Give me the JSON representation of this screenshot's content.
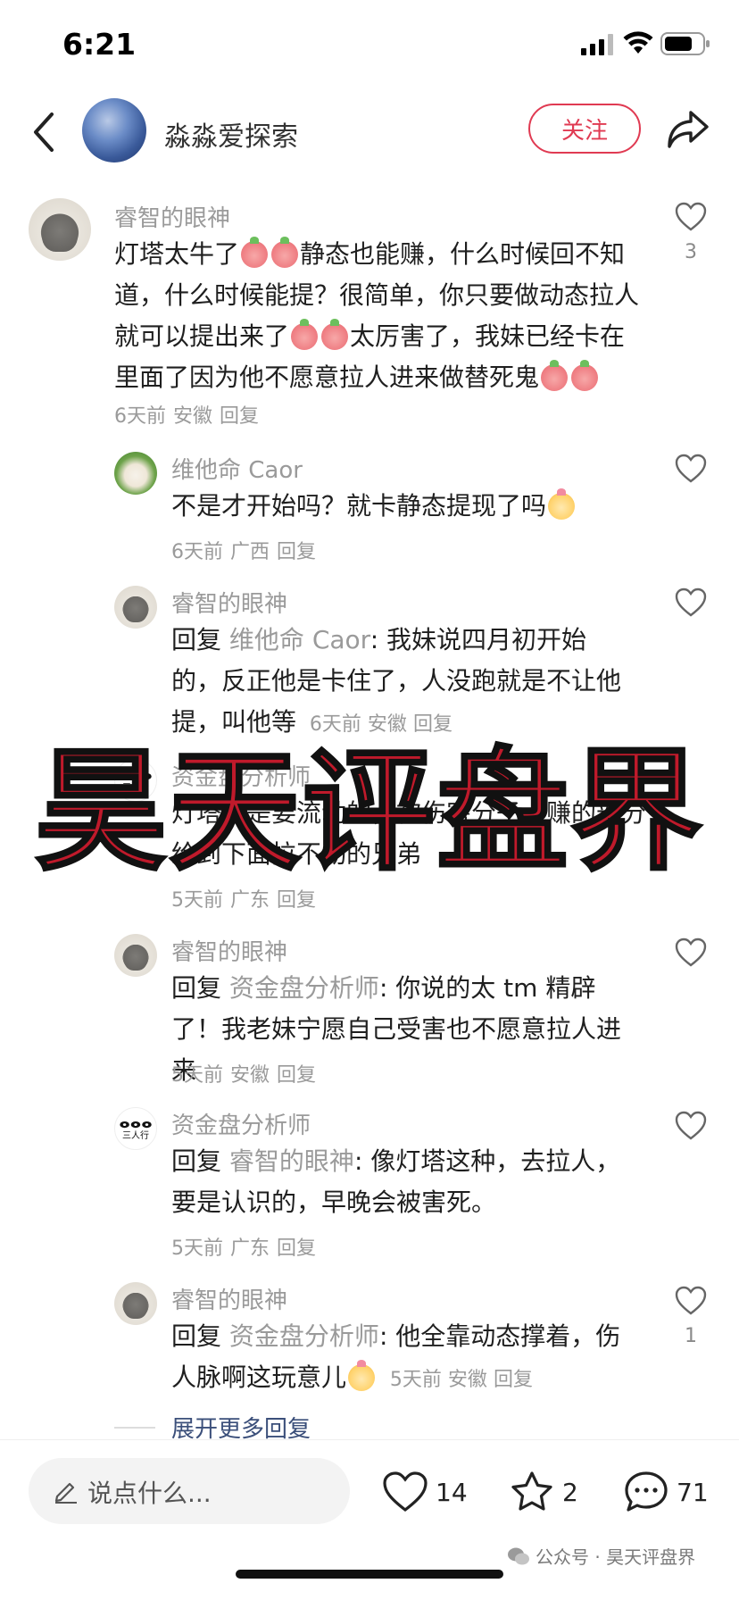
{
  "status_bar": {
    "time": "6:21"
  },
  "header": {
    "author": "淼淼爱探索",
    "follow_label": "关注"
  },
  "comments": {
    "c1": {
      "name": "睿智的眼神",
      "text_a": "灯塔太牛了",
      "text_b": "静态也能赚，什么时候回不知道，什么时候能提？很简单，你只要做动态拉人就可以提出来了",
      "text_c": "太厉害了，我妹已经卡在里面了因为他不愿意拉人进来做替死鬼",
      "time": "6天前",
      "region": "安徽",
      "reply": "回复",
      "like_count": "3"
    },
    "c2": {
      "name": "维他命 Caor",
      "text": "不是才开始吗？就卡静态提现了吗",
      "time": "6天前",
      "region": "广西",
      "reply": "回复"
    },
    "c3": {
      "name": "睿智的眼神",
      "reply_word": "回复",
      "target": "维他命 Caor",
      "text": ": 我妹说四月初开始的，反正他是卡住了，人没跑就是不让他提，叫他等",
      "time": "6天前",
      "region": "安徽",
      "reply": "回复"
    },
    "c4": {
      "name": "资金盘分析师",
      "text": "灯塔就是要流动的，被伤害分子，赚的部分给到下面拉不动的兄弟",
      "time": "5天前",
      "region": "广东",
      "reply": "回复"
    },
    "c5": {
      "name": "睿智的眼神",
      "reply_word": "回复",
      "target": "资金盘分析师",
      "text": ": 你说的太 tm 精辟了！我老妹宁愿自己受害也不愿意拉人进来",
      "time": "5天前",
      "region": "安徽",
      "reply": "回复"
    },
    "c6": {
      "name": "资金盘分析师",
      "reply_word": "回复",
      "target": "睿智的眼神",
      "text": ": 像灯塔这种，去拉人，要是认识的，早晚会被害死。",
      "time": "5天前",
      "region": "广东",
      "reply": "回复"
    },
    "c7": {
      "name": "睿智的眼神",
      "reply_word": "回复",
      "target": "资金盘分析师",
      "text": ": 他全靠动态撑着，伤人脉啊这玩意儿",
      "time": "5天前",
      "region": "安徽",
      "reply": "回复",
      "like_count": "1"
    },
    "expand": "展开更多回复"
  },
  "avatar_logo": {
    "glyph": "ⴰⴰⴰ",
    "sub": "三人行"
  },
  "watermark": "昊天评盘界",
  "bottom_bar": {
    "input_placeholder": "说点什么...",
    "like_count": "14",
    "fav_count": "2",
    "comment_count": "71"
  },
  "footer_watermark": "公众号 · 昊天评盘界",
  "colors": {
    "accent": "#e03a52",
    "link": "#3b4f7a",
    "watermark": "#c01a2b"
  },
  "icons": [
    "back-icon",
    "share-icon",
    "heart-icon",
    "star-icon",
    "comment-icon",
    "pencil-icon",
    "wechat-icon"
  ]
}
